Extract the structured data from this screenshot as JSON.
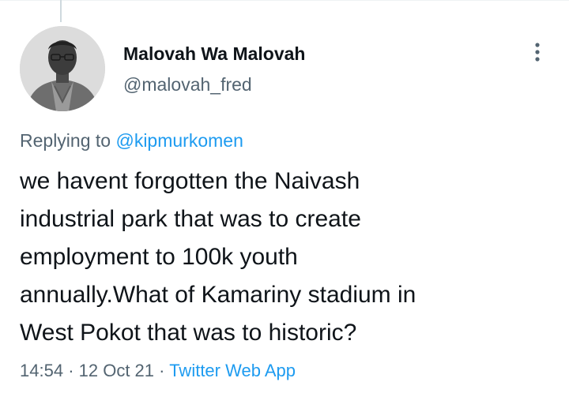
{
  "tweet": {
    "author": {
      "display_name": "Malovah Wa Malovah",
      "handle": "@malovah_fred"
    },
    "replying_prefix": "Replying to",
    "replying_to": "@kipmurkomen",
    "text_lines": [
      "we havent forgotten the Naivash",
      "industrial park that was to create",
      "employment to 100k youth",
      "annually.What of Kamariny stadium in",
      "West Pokot that was to historic?"
    ],
    "time": "14:54",
    "date": "12 Oct 21",
    "separator": "·",
    "source": "Twitter Web App"
  },
  "icons": {
    "more": "more-vertical-icon",
    "avatar": "user-avatar-photo"
  },
  "colors": {
    "text_primary": "#0f1419",
    "text_secondary": "#536471",
    "link": "#1d9bf0",
    "divider": "#eff3f4",
    "thread_line": "#cfd9de"
  }
}
